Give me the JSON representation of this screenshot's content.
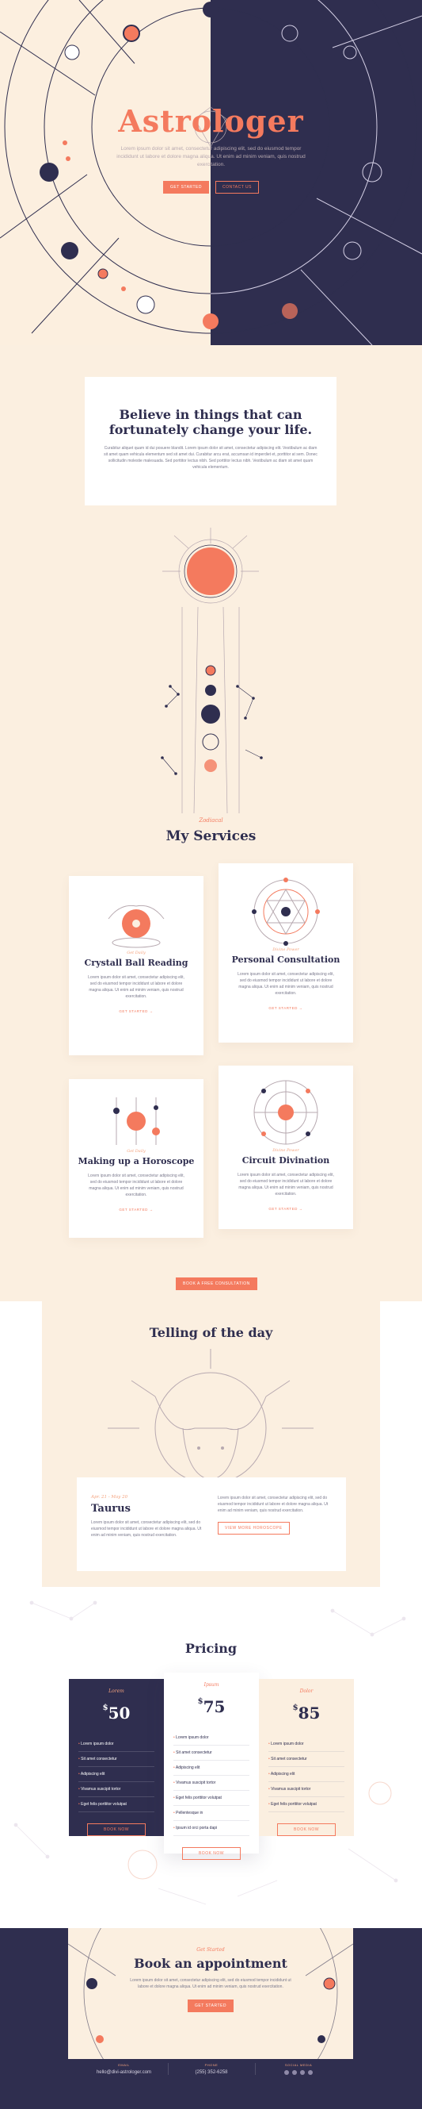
{
  "hero": {
    "title": "Astrologer",
    "subtitle": "Lorem ipsum dolor sit amet, consectetur adipiscing elit, sed do eiusmod tempor incididunt ut labore et dolore magna aliqua. Ut enim ad minim veniam, quis nostrud exercitation.",
    "primary_button": "Get started",
    "secondary_button": "Contact us"
  },
  "believe": {
    "title_line1": "Believe in things that can",
    "title_line2": "fortunately change your life.",
    "text": "Curabitur aliquet quam id dui posuere blandit. Lorem ipsum dolor sit amet, consectetur adipiscing elit. Vestibulum ac diam sit amet quam vehicula elementum sed sit amet dui. Curabitur arcu erat, accumsan id imperdiet et, porttitor at sem. Donec sollicitudin molestie malesuada. Sed porttitor lectus nibh. Sed porttitor lectus nibh. Vestibulum ac diam sit amet quam vehicula elementum."
  },
  "services": {
    "eyebrow": "Zodiacal",
    "title": "My Services",
    "cards": [
      {
        "category": "Get Daily",
        "name": "Crystall Ball Reading",
        "desc": "Lorem ipsum dolor sit amet, consectetur adipiscing elit, sed do eiusmod tempor incididunt ut labore et dolore magna aliqua. Ut enim ad minim veniam, quis nostrud exercitation.",
        "more": "Get started →"
      },
      {
        "category": "Divine Power",
        "name": "Personal Consultation",
        "desc": "Lorem ipsum dolor sit amet, consectetur adipiscing elit, sed do eiusmod tempor incididunt ut labore et dolore magna aliqua. Ut enim ad minim veniam, quis nostrud exercitation.",
        "more": "Get started →"
      },
      {
        "category": "Get Daily",
        "name": "Making up a Horoscope",
        "desc": "Lorem ipsum dolor sit amet, consectetur adipiscing elit, sed do eiusmod tempor incididunt ut labore et dolore magna aliqua. Ut enim ad minim veniam, quis nostrud exercitation.",
        "more": "Get started →"
      },
      {
        "category": "Divine Power",
        "name": "Circuit Divination",
        "desc": "Lorem ipsum dolor sit amet, consectetur adipiscing elit, sed do eiusmod tempor incididunt ut labore et dolore magna aliqua. Ut enim ad minim veniam, quis nostrud exercitation.",
        "more": "Get started →"
      }
    ],
    "button": "Book a free consultation"
  },
  "telling": {
    "title": "Telling of the day",
    "date": "Apr. 21 - May 20",
    "sign": "Taurus",
    "text_left": "Lorem ipsum dolor sit amet, consectetur adipiscing elit, sed do eiusmod tempor incididunt ut labore et dolore magna aliqua. Ut enim ad minim veniam, quis nostrud exercitation.",
    "text_right": "Lorem ipsum dolor sit amet, consectetur adipiscing elit, sed do eiusmod tempor incididunt ut labore et dolore magna aliqua. Ut enim ad minim veniam, quis nostrud exercitation.",
    "button": "View more horoscope"
  },
  "pricing": {
    "title": "Pricing",
    "plans": [
      {
        "name": "Lorem",
        "currency": "$",
        "amount": "50",
        "features": [
          "Lorem ipsum dolor",
          "Sit amet consectetur",
          "Adipiscing elit",
          "Vivamus suscipit tortor",
          "Eget felis porttitor volutpat"
        ],
        "button": "Book now"
      },
      {
        "name": "Ipsum",
        "currency": "$",
        "amount": "75",
        "features": [
          "Lorem ipsum dolor",
          "Sit amet consectetur",
          "Adipiscing elit",
          "Vivamus suscipit tortor",
          "Eget felis porttitor volutpat",
          "Pellentesque in",
          "Ipsum id orci porta dapi"
        ],
        "button": "Book now"
      },
      {
        "name": "Dolor",
        "currency": "$",
        "amount": "85",
        "features": [
          "Lorem ipsum dolor",
          "Sit amet consectetur",
          "Adipiscing elit",
          "Vivamus suscipit tortor",
          "Eget felis porttitor volutpat"
        ],
        "button": "Book now"
      }
    ]
  },
  "appointment": {
    "eyebrow": "Get Started",
    "title": "Book an appointment",
    "text": "Lorem ipsum dolor sit amet, consectetur adipiscing elit, sed do eiusmod tempor incididunt ut labore et dolore magna aliqua. Ut enim ad minim veniam, quis nostrud exercitation.",
    "button": "Get started"
  },
  "footer": {
    "email_label": "Email",
    "email": "hello@divi-astrologer.com",
    "phone_label": "Phone",
    "phone": "(255) 352-6258",
    "social_label": "Social Media"
  },
  "colors": {
    "navy": "#2f2e4f",
    "cream": "#fbefe0",
    "coral": "#f47a5e"
  }
}
